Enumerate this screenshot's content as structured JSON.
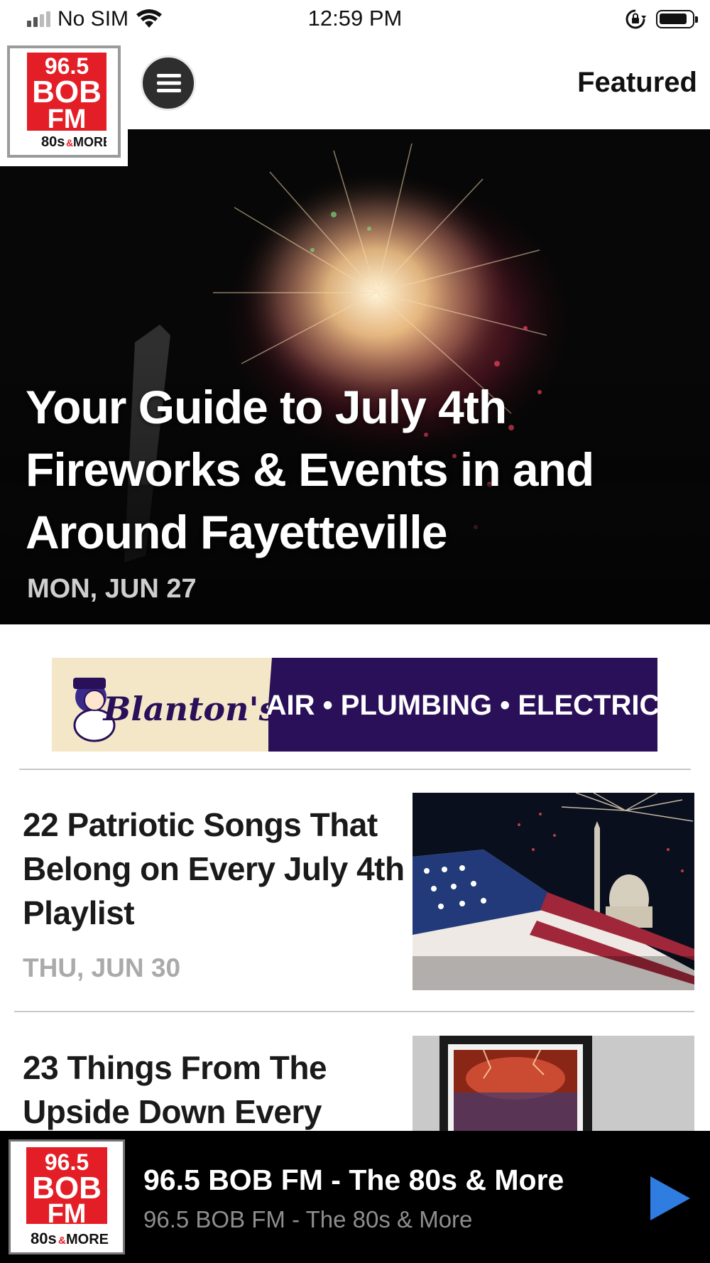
{
  "status_bar": {
    "carrier": "No SIM",
    "time": "12:59 PM",
    "icons": [
      "signal-icon",
      "wifi-icon",
      "orientation-lock-icon",
      "battery-icon"
    ]
  },
  "header": {
    "logo": {
      "line1": "96.5",
      "line2": "BOB",
      "line3": "FM",
      "line4_a": "80s",
      "line4_b": "&",
      "line4_c": "MORE"
    },
    "menu_icon": "hamburger-menu-icon",
    "section_title": "Featured"
  },
  "hero": {
    "title": "Your Guide to July 4th Fireworks & Events in and Around Fayetteville",
    "date": "MON, JUN 27"
  },
  "ad": {
    "brand": "Blanton's",
    "tagline": "AIR • PLUMBING • ELECTRIC",
    "colors": {
      "left_bg": "#f3e7c8",
      "right_bg": "#2a1059",
      "text": "#ffffff"
    }
  },
  "articles": [
    {
      "title": "22 Patriotic Songs That Belong on Every July 4th Playlist",
      "date": "THU, JUN 30"
    },
    {
      "title": "23 Things From The Upside Down Every",
      "date": ""
    }
  ],
  "player": {
    "title": "96.5 BOB FM - The 80s & More",
    "subtitle": "96.5 BOB FM - The 80s & More",
    "play_icon": "play-icon"
  },
  "colors": {
    "brand_red": "#e41e26",
    "play_blue": "#2f7de1",
    "date_gray": "#aaaaaa"
  }
}
